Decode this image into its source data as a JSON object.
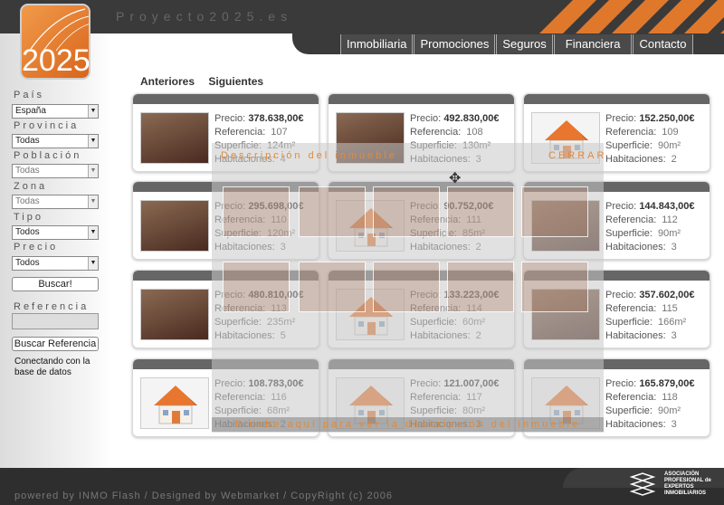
{
  "header": {
    "site_title": "Proyecto2025.es",
    "logo_text": "2025"
  },
  "nav": [
    "Inmobiliaria",
    "Promociones",
    "Seguros",
    "Financiera",
    "Contacto"
  ],
  "filters": [
    {
      "label": "País",
      "value": "España"
    },
    {
      "label": "Provincia",
      "value": "Todas"
    },
    {
      "label": "Población",
      "value": "Todas"
    },
    {
      "label": "Zona",
      "value": "Todas"
    },
    {
      "label": "Tipo",
      "value": "Todos"
    },
    {
      "label": "Precio",
      "value": "Todos"
    }
  ],
  "search_button": "Buscar!",
  "reference": {
    "label": "Referencia",
    "value": "",
    "button": "Buscar Referencia"
  },
  "status": "Conectando con la base de datos",
  "paging": {
    "prev": "Anteriores",
    "next": "Siguientes"
  },
  "field_labels": {
    "price": "Precio:",
    "ref": "Referencia:",
    "area": "Superficie:",
    "rooms": "Habitaciones:"
  },
  "properties": [
    {
      "price": "378.638,00€",
      "ref": "107",
      "area": "124m²",
      "rooms": "4",
      "image": "photo"
    },
    {
      "price": "492.830,00€",
      "ref": "108",
      "area": "130m²",
      "rooms": "3",
      "image": "photo"
    },
    {
      "price": "152.250,00€",
      "ref": "109",
      "area": "90m²",
      "rooms": "2",
      "image": "house-icon"
    },
    {
      "price": "295.698,00€",
      "ref": "110",
      "area": "120m²",
      "rooms": "3",
      "image": "photo"
    },
    {
      "price": "90.752,00€",
      "ref": "111",
      "area": "85m²",
      "rooms": "2",
      "image": "house-icon"
    },
    {
      "price": "144.843,00€",
      "ref": "112",
      "area": "90m²",
      "rooms": "3",
      "image": "photo"
    },
    {
      "price": "480.810,00€",
      "ref": "113",
      "area": "235m²",
      "rooms": "5",
      "image": "photo"
    },
    {
      "price": "133.223,00€",
      "ref": "114",
      "area": "60m²",
      "rooms": "2",
      "image": "house-icon"
    },
    {
      "price": "357.602,00€",
      "ref": "115",
      "area": "166m²",
      "rooms": "3",
      "image": "photo"
    },
    {
      "price": "108.783,00€",
      "ref": "116",
      "area": "68m²",
      "rooms": "2",
      "image": "house-icon"
    },
    {
      "price": "121.007,00€",
      "ref": "117",
      "area": "80m²",
      "rooms": "3",
      "image": "house-icon"
    },
    {
      "price": "165.879,00€",
      "ref": "118",
      "area": "90m²",
      "rooms": "3",
      "image": "house-icon"
    }
  ],
  "overlay": {
    "title": "Descripción del inmueble",
    "close": "CERRAR",
    "caption": "Pinche aquí para ver la descripción del inmueble"
  },
  "footer": {
    "text": "powered by INMO Flash / Designed by Webmarket / CopyRight (c) 2006",
    "association": "ASOCIACIÓN PROFESIONAL de EXPERTOS INMOBILIARIOS"
  },
  "colors": {
    "accent": "#e0782c",
    "dark": "#3a3a3a"
  }
}
